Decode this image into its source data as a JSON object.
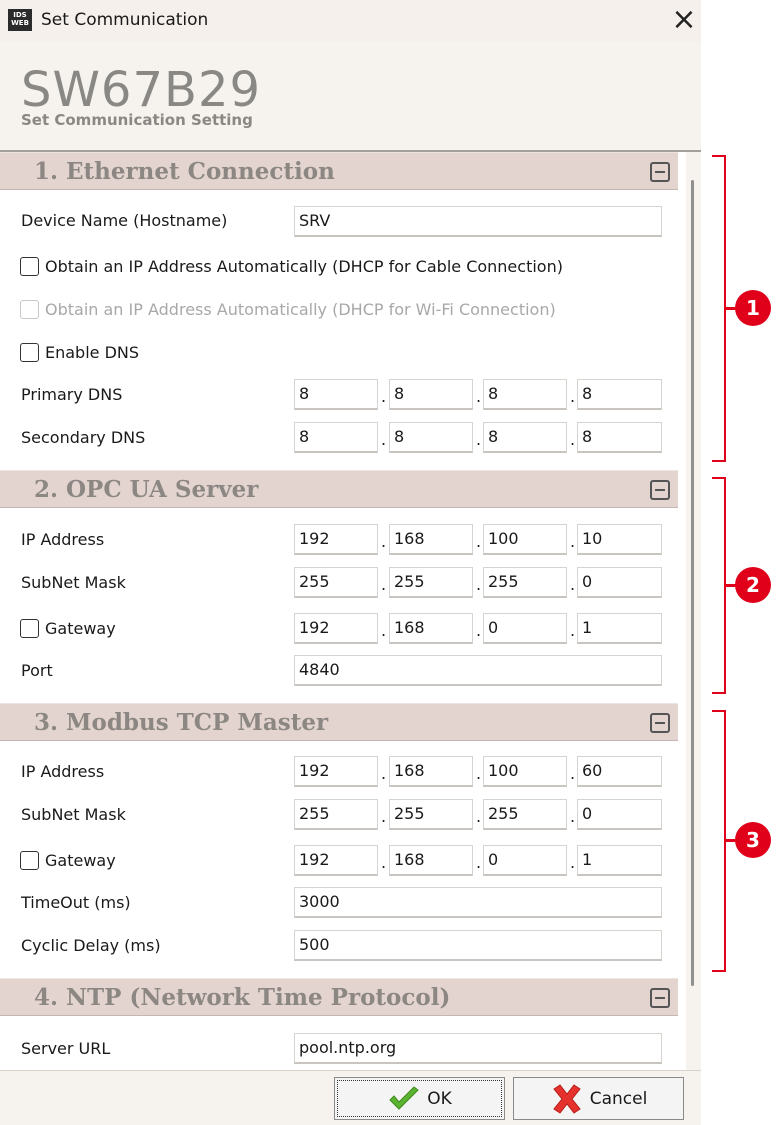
{
  "window": {
    "title": "Set Communication",
    "app_icon_text": "IDS WEB"
  },
  "header": {
    "model": "SW67B29",
    "subtitle": "Set Communication Setting"
  },
  "sections": {
    "ethernet": {
      "title": "1. Ethernet Connection",
      "hostname_label": "Device Name (Hostname)",
      "hostname_value": "SRV",
      "dhcp_cable_label": "Obtain an IP Address Automatically (DHCP for Cable Connection)",
      "dhcp_wifi_label": "Obtain an IP Address Automatically (DHCP for Wi-Fi Connection)",
      "enable_dns_label": "Enable DNS",
      "primary_dns_label": "Primary DNS",
      "primary_dns": [
        "8",
        "8",
        "8",
        "8"
      ],
      "secondary_dns_label": "Secondary DNS",
      "secondary_dns": [
        "8",
        "8",
        "8",
        "8"
      ]
    },
    "opcua": {
      "title": "2. OPC UA Server",
      "ip_label": "IP Address",
      "ip": [
        "192",
        "168",
        "100",
        "10"
      ],
      "mask_label": "SubNet Mask",
      "mask": [
        "255",
        "255",
        "255",
        "0"
      ],
      "gateway_label": "Gateway",
      "gateway": [
        "192",
        "168",
        "0",
        "1"
      ],
      "port_label": "Port",
      "port_value": "4840"
    },
    "modbus": {
      "title": "3. Modbus TCP Master",
      "ip_label": "IP Address",
      "ip": [
        "192",
        "168",
        "100",
        "60"
      ],
      "mask_label": "SubNet Mask",
      "mask": [
        "255",
        "255",
        "255",
        "0"
      ],
      "gateway_label": "Gateway",
      "gateway": [
        "192",
        "168",
        "0",
        "1"
      ],
      "timeout_label": "TimeOut (ms)",
      "timeout_value": "3000",
      "cyclic_label": "Cyclic Delay (ms)",
      "cyclic_value": "500"
    },
    "ntp": {
      "title": "4. NTP (Network Time Protocol)",
      "server_url_label": "Server URL",
      "server_url_value": "pool.ntp.org"
    }
  },
  "footer": {
    "ok_label": "OK",
    "cancel_label": "Cancel"
  },
  "annotations": {
    "badge1": "1",
    "badge2": "2",
    "badge3": "3",
    "accent_color": "#e0001a"
  },
  "icons": {
    "ok": "green-check-icon",
    "cancel": "red-x-icon",
    "close": "close-icon",
    "collapse": "collapse-minus-icon"
  }
}
